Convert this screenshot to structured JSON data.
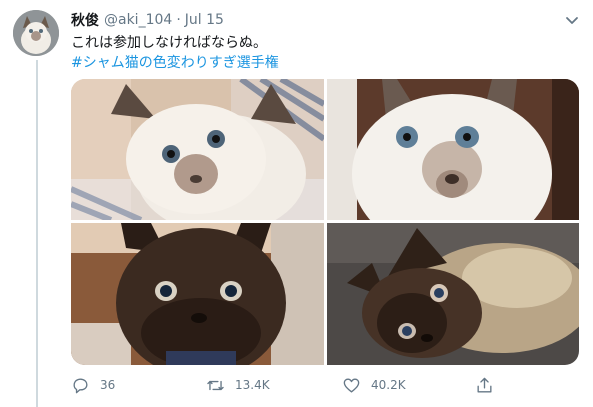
{
  "tweet": {
    "author_name": "秋俊",
    "handle": "@aki_104",
    "separator": "·",
    "date": "Jul 15",
    "text_line": "これは参加しなければならぬ。",
    "hashtag": "#シャム猫の色変わりすぎ選手権"
  },
  "media": {
    "photos": [
      {
        "label": "cat-photo-1"
      },
      {
        "label": "cat-photo-2"
      },
      {
        "label": "cat-photo-3"
      },
      {
        "label": "cat-photo-4"
      }
    ]
  },
  "actions": {
    "reply_count": "36",
    "retweet_count": "13.4K",
    "like_count": "40.2K"
  },
  "icons": {
    "menu": "chevron-down-icon",
    "reply": "reply-icon",
    "retweet": "retweet-icon",
    "like": "heart-icon",
    "share": "share-icon"
  },
  "colors": {
    "link": "#1b95e0",
    "secondary_text": "#657786",
    "primary_text": "#14171a"
  }
}
